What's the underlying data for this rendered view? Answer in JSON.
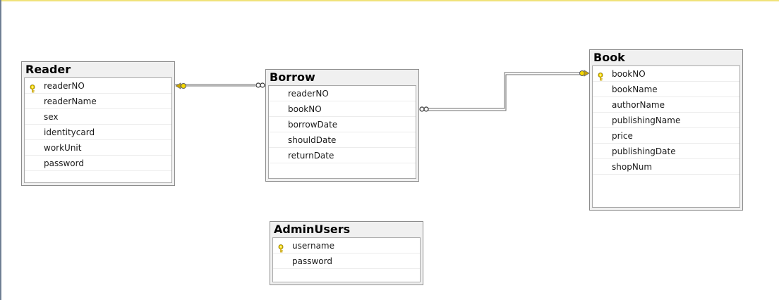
{
  "tables": {
    "reader": {
      "title": "Reader",
      "key_index": 0,
      "columns": [
        "readerNO",
        "readerName",
        "sex",
        "identitycard",
        "workUnit",
        "password"
      ]
    },
    "borrow": {
      "title": "Borrow",
      "key_index": -1,
      "columns": [
        "readerNO",
        "bookNO",
        "borrowDate",
        "shouldDate",
        "returnDate"
      ]
    },
    "book": {
      "title": "Book",
      "key_index": 0,
      "columns": [
        "bookNO",
        "bookName",
        "authorName",
        "publishingName",
        "price",
        "publishingDate",
        "shopNum"
      ]
    },
    "adminusers": {
      "title": "AdminUsers",
      "key_index": 0,
      "columns": [
        "username",
        "password"
      ]
    }
  },
  "relationships": [
    {
      "from_table": "Reader",
      "to_table": "Borrow",
      "from_end": "one",
      "to_end": "many"
    },
    {
      "from_table": "Book",
      "to_table": "Borrow",
      "from_end": "one",
      "to_end": "many"
    }
  ],
  "colors": {
    "key": "#e8c400",
    "connector": "#6e6e6e",
    "title_bar": "#f0f0f0"
  }
}
